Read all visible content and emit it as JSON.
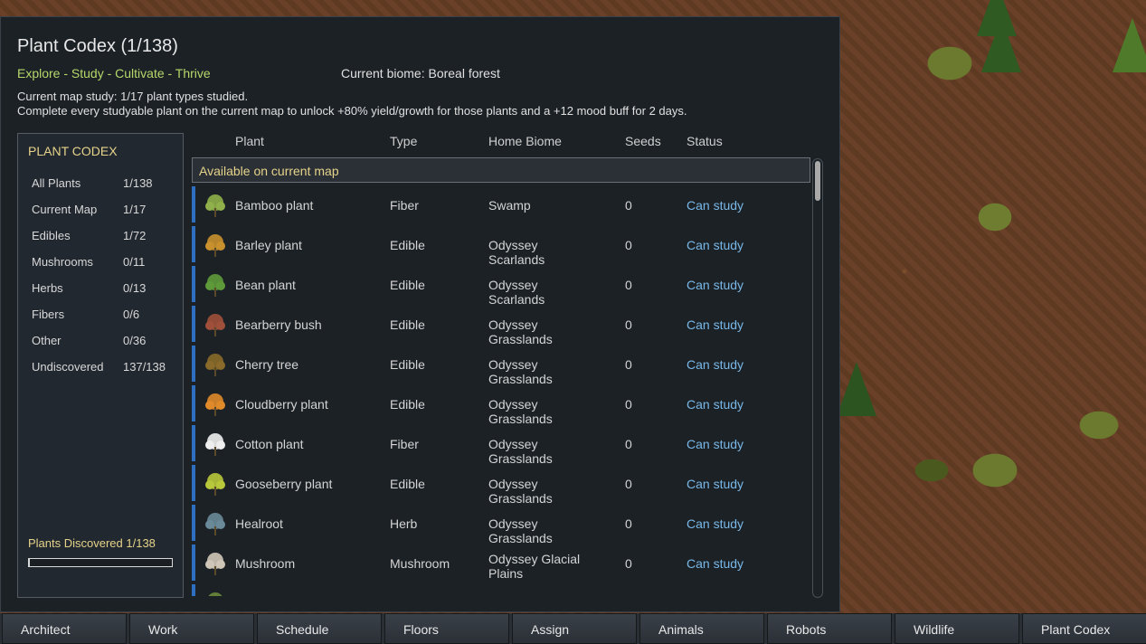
{
  "window": {
    "title": "Plant Codex (1/138)",
    "tagline": "Explore - Study - Cultivate - Thrive",
    "biome": "Current biome: Boreal forest",
    "study_line1": "Current map study: 1/17 plant types studied.",
    "study_line2": "Complete every studyable plant on the current map to unlock +80% yield/growth for those plants and a +12 mood buff for 2 days."
  },
  "sidebar": {
    "title": "PLANT CODEX",
    "categories": [
      {
        "label": "All Plants",
        "count": "1/138"
      },
      {
        "label": "Current Map",
        "count": "1/17"
      },
      {
        "label": "Edibles",
        "count": "1/72"
      },
      {
        "label": "Mushrooms",
        "count": "0/11"
      },
      {
        "label": "Herbs",
        "count": "0/13"
      },
      {
        "label": "Fibers",
        "count": "0/6"
      },
      {
        "label": "Other",
        "count": "0/36"
      },
      {
        "label": "Undiscovered",
        "count": "137/138"
      }
    ],
    "discovered_label": "Plants Discovered 1/138",
    "discovered_fraction": 0.007
  },
  "table": {
    "headers": {
      "plant": "Plant",
      "type": "Type",
      "biome": "Home Biome",
      "seeds": "Seeds",
      "status": "Status"
    },
    "section_label": "Available on current map",
    "rows": [
      {
        "name": "Bamboo plant",
        "type": "Fiber",
        "biome": "Swamp",
        "seeds": "0",
        "status": "Can study",
        "icon": "bamboo-icon",
        "color": "#8fb04a"
      },
      {
        "name": "Barley plant",
        "type": "Edible",
        "biome": "Odyssey Scarlands",
        "seeds": "0",
        "status": "Can study",
        "icon": "barley-icon",
        "color": "#c9912e"
      },
      {
        "name": "Bean plant",
        "type": "Edible",
        "biome": "Odyssey Scarlands",
        "seeds": "0",
        "status": "Can study",
        "icon": "bean-icon",
        "color": "#5f9a3a"
      },
      {
        "name": "Bearberry bush",
        "type": "Edible",
        "biome": "Odyssey Grasslands",
        "seeds": "0",
        "status": "Can study",
        "icon": "bearberry-icon",
        "color": "#a0503a"
      },
      {
        "name": "Cherry tree",
        "type": "Edible",
        "biome": "Odyssey Grasslands",
        "seeds": "0",
        "status": "Can study",
        "icon": "cherry-tree-icon",
        "color": "#8a6a2a"
      },
      {
        "name": "Cloudberry plant",
        "type": "Edible",
        "biome": "Odyssey Grasslands",
        "seeds": "0",
        "status": "Can study",
        "icon": "cloudberry-icon",
        "color": "#e08a2a"
      },
      {
        "name": "Cotton plant",
        "type": "Fiber",
        "biome": "Odyssey Grasslands",
        "seeds": "0",
        "status": "Can study",
        "icon": "cotton-icon",
        "color": "#eeeeee"
      },
      {
        "name": "Gooseberry plant",
        "type": "Edible",
        "biome": "Odyssey Grasslands",
        "seeds": "0",
        "status": "Can study",
        "icon": "gooseberry-icon",
        "color": "#b8c83a"
      },
      {
        "name": "Healroot",
        "type": "Herb",
        "biome": "Odyssey Grasslands",
        "seeds": "0",
        "status": "Can study",
        "icon": "healroot-icon",
        "color": "#6a8a9a"
      },
      {
        "name": "Mushroom",
        "type": "Mushroom",
        "biome": "Odyssey Glacial Plains",
        "seeds": "0",
        "status": "Can study",
        "icon": "mushroom-icon",
        "color": "#cfc6b8"
      },
      {
        "name": "",
        "type": "",
        "biome": "",
        "seeds": "",
        "status": "",
        "icon": "plant-icon",
        "color": "#6a8a3a"
      }
    ]
  },
  "tabs": [
    "Architect",
    "Work",
    "Schedule",
    "Floors",
    "Assign",
    "Animals",
    "Robots",
    "Wildlife",
    "Plant Codex"
  ]
}
